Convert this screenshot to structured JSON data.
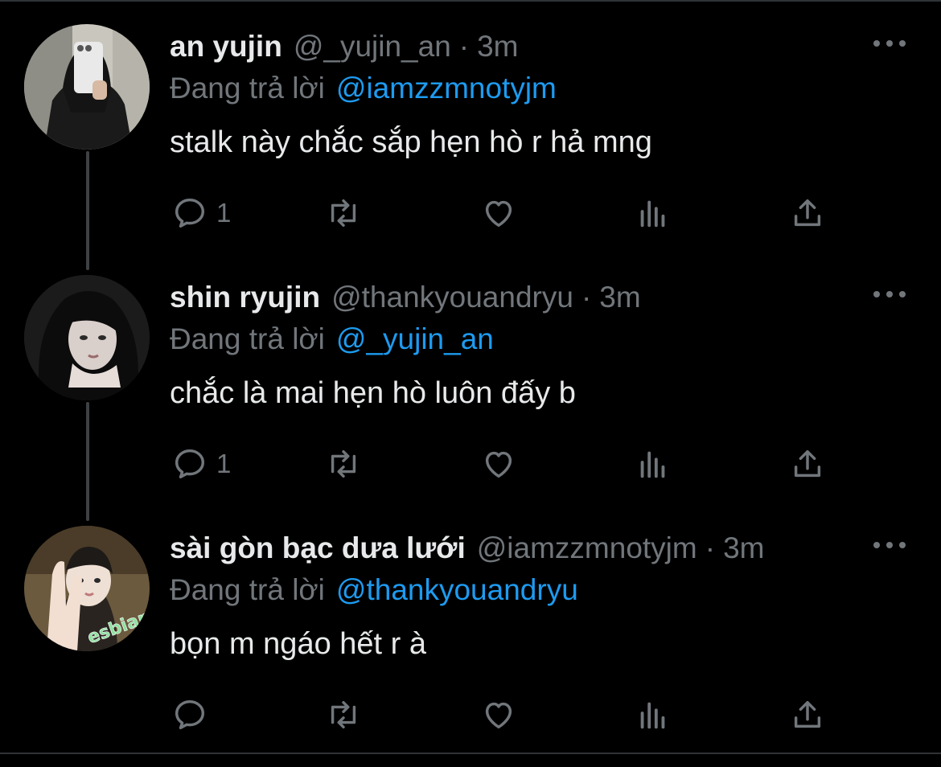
{
  "colors": {
    "background": "#000000",
    "text": "#e7e9ea",
    "muted": "#71767b",
    "link": "#1d9bf0",
    "thread_line": "#3e4144"
  },
  "tweets": [
    {
      "name": "an yujin",
      "handle": "@_yujin_an",
      "separator": "·",
      "time": "3m",
      "reply_prefix": "Đang trả lời",
      "reply_to": "@iamzzmnotyjm",
      "text": "stalk này chắc sắp hẹn hò r hả mng",
      "reply_count": "1",
      "icons": [
        "reply-icon",
        "retweet-icon",
        "like-icon",
        "views-icon",
        "share-icon",
        "more-icon"
      ]
    },
    {
      "name": "shin ryujin",
      "handle": "@thankyouandryu",
      "separator": "·",
      "time": "3m",
      "reply_prefix": "Đang trả lời",
      "reply_to": "@_yujin_an",
      "text": "chắc là mai hẹn hò luôn đấy b",
      "reply_count": "1",
      "icons": [
        "reply-icon",
        "retweet-icon",
        "like-icon",
        "views-icon",
        "share-icon",
        "more-icon"
      ]
    },
    {
      "name": "sài gòn bạc dưa lưới",
      "handle": "@iamzzmnotyjm",
      "separator": "·",
      "time": "3m",
      "reply_prefix": "Đang trả lời",
      "reply_to": "@thankyouandryu",
      "text": "bọn m ngáo hết r à",
      "reply_count": "",
      "avatar_sticker": "esbian",
      "icons": [
        "reply-icon",
        "retweet-icon",
        "like-icon",
        "views-icon",
        "share-icon",
        "more-icon"
      ]
    }
  ]
}
